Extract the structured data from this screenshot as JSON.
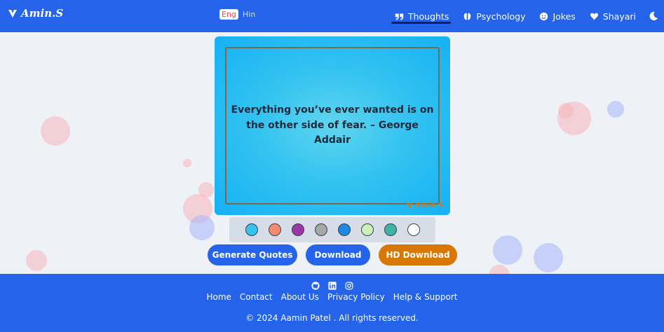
{
  "header": {
    "logo_text": "Amin.S",
    "lang": {
      "eng": "Eng",
      "hin": "Hin"
    },
    "nav": [
      {
        "label": "Thoughts",
        "icon": "quote-icon"
      },
      {
        "label": "Psychology",
        "icon": "brain-icon"
      },
      {
        "label": "Jokes",
        "icon": "smile-icon"
      },
      {
        "label": "Shayari",
        "icon": "heart-icon"
      }
    ],
    "theme_icon": "moon-icon"
  },
  "card": {
    "quote": "Everything you’ve ever wanted is on the other side of fear. – George Addair",
    "watermark": "Amin.S"
  },
  "swatches": [
    "#38c2ef",
    "#f58b6a",
    "#9b36a8",
    "#a7a7a7",
    "#1e88e5",
    "#cdf0b8",
    "#3fb3a4",
    "#ffffff"
  ],
  "buttons": {
    "generate": "Generate Quotes",
    "download": "Download",
    "hd_download": "HD Download"
  },
  "footer": {
    "social_icons": [
      "github-icon",
      "linkedin-icon",
      "instagram-icon"
    ],
    "links": [
      "Home",
      "Contact",
      "About Us",
      "Privacy Policy",
      "Help & Support"
    ],
    "copyright": "© 2024 Aamin Patel . All rights reserved."
  },
  "colors": {
    "brand": "#2563eb",
    "accent": "#d97706"
  }
}
